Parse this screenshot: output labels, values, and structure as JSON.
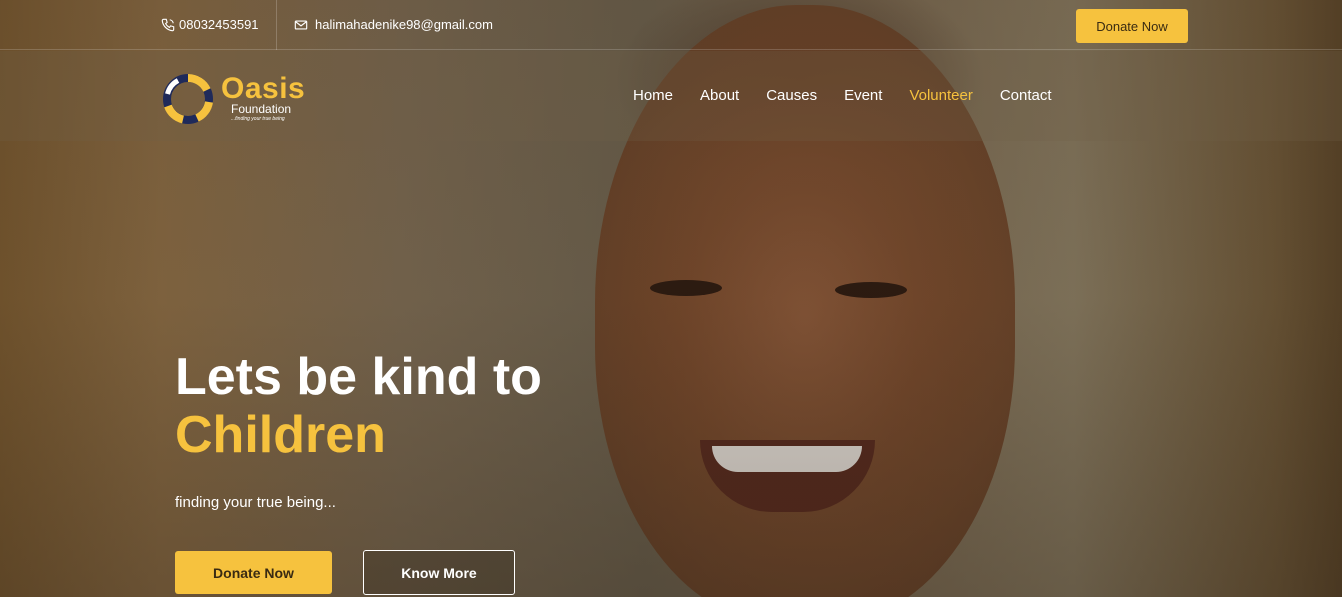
{
  "topbar": {
    "phone": "08032453591",
    "email": "halimahadenike98@gmail.com",
    "donate_label": "Donate Now"
  },
  "logo": {
    "title": "Oasis",
    "subtitle": "Foundation",
    "tagline": "...finding your true being"
  },
  "nav": {
    "items": [
      {
        "label": "Home"
      },
      {
        "label": "About"
      },
      {
        "label": "Causes"
      },
      {
        "label": "Event"
      },
      {
        "label": "Volunteer",
        "active": true
      },
      {
        "label": "Contact"
      }
    ]
  },
  "hero": {
    "title_line1": "Lets be kind to",
    "title_line2": "Children",
    "subtitle": "finding your true being...",
    "primary_button": "Donate Now",
    "secondary_button": "Know More"
  },
  "colors": {
    "accent": "#f6c23e",
    "text_light": "#ffffff",
    "button_text_dark": "#3a2b12"
  },
  "icons": [
    "phone-icon",
    "envelope-icon",
    "logo-ring-icon"
  ]
}
